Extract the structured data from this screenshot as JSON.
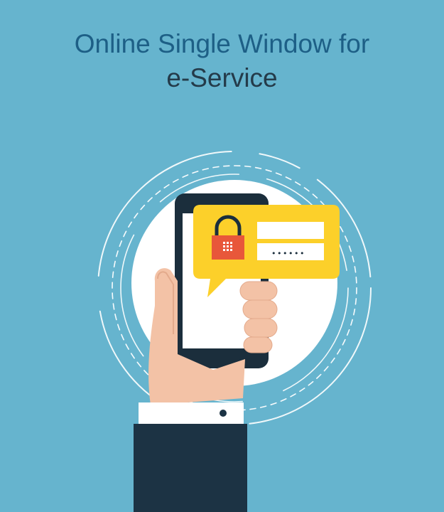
{
  "title": {
    "line1": "Online Single Window for",
    "line2": "e-Service"
  },
  "illustration": {
    "password_mask": "••••••",
    "icons": [
      "smartphone-icon",
      "padlock-icon",
      "hand-icon"
    ]
  },
  "colors": {
    "background": "#66b4ce",
    "title_primary": "#1d5f86",
    "title_secondary": "#243b4a",
    "bubble": "#fcd02a",
    "padlock": "#e8573a",
    "phone": "#1b2e3c",
    "sleeve": "#1c3344",
    "skin": "#f3c2a6"
  }
}
